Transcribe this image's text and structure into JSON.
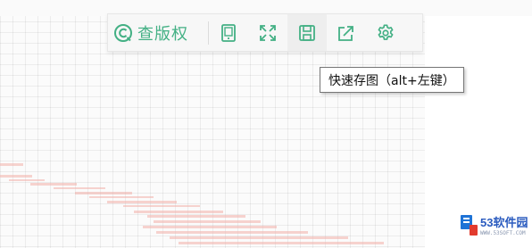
{
  "toolbar": {
    "copyright_label": "查版权",
    "tools": [
      {
        "name": "tablet-icon",
        "label": ""
      },
      {
        "name": "fullscreen-icon",
        "label": ""
      },
      {
        "name": "save-icon",
        "label": ""
      },
      {
        "name": "share-icon",
        "label": ""
      },
      {
        "name": "settings-icon",
        "label": ""
      }
    ],
    "accent_color": "#43b084"
  },
  "tooltip": {
    "text": "快速存图（alt+左键）"
  },
  "watermark": {
    "name": "53软件园",
    "url": "WWW.53SOFT.COM"
  }
}
